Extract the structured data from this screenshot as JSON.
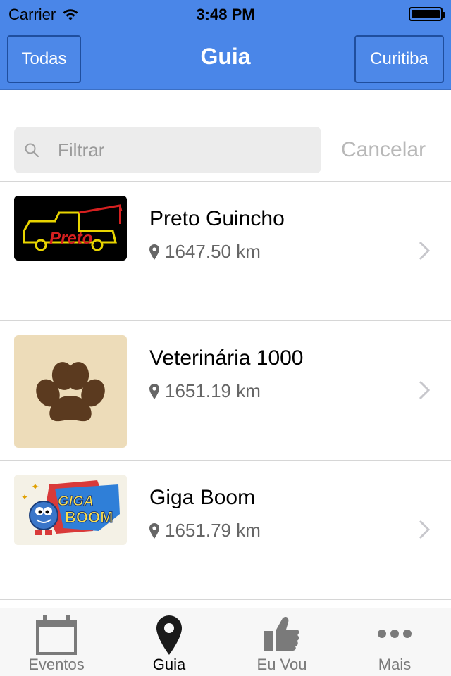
{
  "status_bar": {
    "carrier": "Carrier",
    "time": "3:48 PM"
  },
  "nav": {
    "left_button": "Todas",
    "title": "Guia",
    "right_button": "Curitiba"
  },
  "search": {
    "placeholder": "Filtrar",
    "value": "",
    "cancel_label": "Cancelar"
  },
  "list": [
    {
      "name": "Preto Guincho",
      "distance": "1647.50 km",
      "thumb_text": "Preto"
    },
    {
      "name": "Veterinária 1000",
      "distance": "1651.19 km"
    },
    {
      "name": "Giga Boom",
      "distance": "1651.79 km",
      "thumb_text_1": "GIGA",
      "thumb_text_2": "BOOM"
    }
  ],
  "tabbar": {
    "tabs": [
      {
        "label": "Eventos",
        "icon": "calendar-icon"
      },
      {
        "label": "Guia",
        "icon": "map-pin-icon",
        "active": true
      },
      {
        "label": "Eu Vou",
        "icon": "thumbs-up-icon"
      },
      {
        "label": "Mais",
        "icon": "more-icon"
      }
    ]
  },
  "colors": {
    "header": "#4a86e8",
    "nav_border": "#1f4e9e",
    "active_tab": "#000000",
    "inactive_tab": "#7a7a7a"
  }
}
